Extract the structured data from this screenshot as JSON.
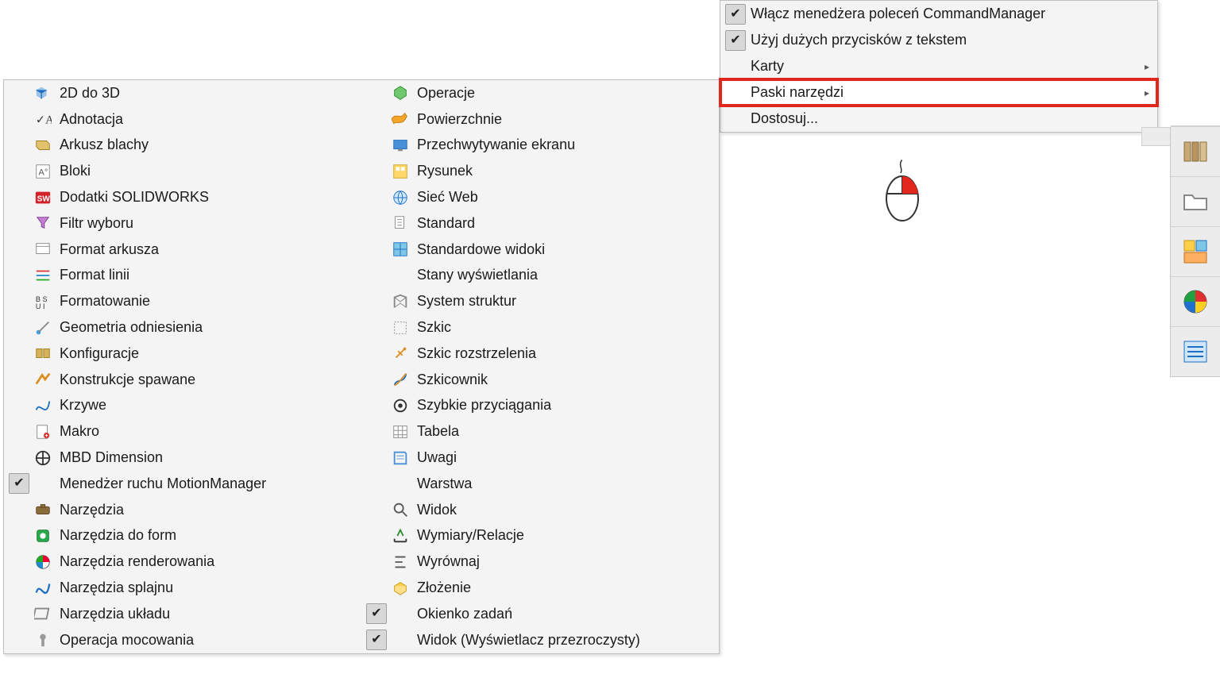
{
  "context_menu": {
    "items": [
      {
        "label": "Włącz menedżera poleceń CommandManager",
        "checked": true,
        "submenu": false,
        "highlight": false
      },
      {
        "label": "Użyj dużych przycisków z tekstem",
        "checked": true,
        "submenu": false,
        "highlight": false
      },
      {
        "label": "Karty",
        "checked": false,
        "submenu": true,
        "highlight": false
      },
      {
        "label": "Paski narzędzi",
        "checked": false,
        "submenu": true,
        "highlight": true
      },
      {
        "label": "Dostosuj...",
        "checked": false,
        "submenu": false,
        "highlight": false
      }
    ]
  },
  "toolbars_submenu": {
    "col1": [
      {
        "label": "2D do 3D",
        "icon": "cube-2d3d",
        "checked": false
      },
      {
        "label": "Adnotacja",
        "icon": "annotation",
        "checked": false
      },
      {
        "label": "Arkusz blachy",
        "icon": "sheetmetal",
        "checked": false
      },
      {
        "label": "Bloki",
        "icon": "blocks",
        "checked": false
      },
      {
        "label": "Dodatki SOLIDWORKS",
        "icon": "sw-addins",
        "checked": false
      },
      {
        "label": "Filtr wyboru",
        "icon": "filter",
        "checked": false
      },
      {
        "label": "Format arkusza",
        "icon": "sheet-format",
        "checked": false
      },
      {
        "label": "Format linii",
        "icon": "line-format",
        "checked": false
      },
      {
        "label": "Formatowanie",
        "icon": "formatting",
        "checked": false
      },
      {
        "label": "Geometria odniesienia",
        "icon": "ref-geom",
        "checked": false
      },
      {
        "label": "Konfiguracje",
        "icon": "configs",
        "checked": false
      },
      {
        "label": "Konstrukcje spawane",
        "icon": "weldments",
        "checked": false
      },
      {
        "label": "Krzywe",
        "icon": "curves",
        "checked": false
      },
      {
        "label": "Makro",
        "icon": "macro",
        "checked": false
      },
      {
        "label": "MBD Dimension",
        "icon": "mbd",
        "checked": false
      },
      {
        "label": "Menedżer ruchu MotionManager",
        "icon": "none",
        "checked": true
      },
      {
        "label": "Narzędzia",
        "icon": "tools",
        "checked": false
      },
      {
        "label": "Narzędzia do form",
        "icon": "mold-tools",
        "checked": false
      },
      {
        "label": "Narzędzia renderowania",
        "icon": "render-tools",
        "checked": false
      },
      {
        "label": "Narzędzia splajnu",
        "icon": "spline-tools",
        "checked": false
      },
      {
        "label": "Narzędzia układu",
        "icon": "layout-tools",
        "checked": false
      },
      {
        "label": "Operacja mocowania",
        "icon": "fastening",
        "checked": false
      }
    ],
    "col2": [
      {
        "label": "Operacje",
        "icon": "features",
        "checked": false
      },
      {
        "label": "Powierzchnie",
        "icon": "surfaces",
        "checked": false
      },
      {
        "label": "Przechwytywanie ekranu",
        "icon": "screen-cap",
        "checked": false
      },
      {
        "label": "Rysunek",
        "icon": "drawing",
        "checked": false
      },
      {
        "label": "Sieć Web",
        "icon": "web",
        "checked": false
      },
      {
        "label": "Standard",
        "icon": "standard",
        "checked": false
      },
      {
        "label": "Standardowe widoki",
        "icon": "std-views",
        "checked": false
      },
      {
        "label": "Stany wyświetlania",
        "icon": "none",
        "checked": false
      },
      {
        "label": "System struktur",
        "icon": "struct-sys",
        "checked": false
      },
      {
        "label": "Szkic",
        "icon": "sketch",
        "checked": false
      },
      {
        "label": "Szkic rozstrzelenia",
        "icon": "explode-sk",
        "checked": false
      },
      {
        "label": "Szkicownik",
        "icon": "sketcher",
        "checked": false
      },
      {
        "label": "Szybkie przyciągania",
        "icon": "quick-snaps",
        "checked": false
      },
      {
        "label": "Tabela",
        "icon": "table",
        "checked": false
      },
      {
        "label": "Uwagi",
        "icon": "notes",
        "checked": false
      },
      {
        "label": "Warstwa",
        "icon": "none",
        "checked": false
      },
      {
        "label": "Widok",
        "icon": "view",
        "checked": false
      },
      {
        "label": "Wymiary/Relacje",
        "icon": "dims-rel",
        "checked": false
      },
      {
        "label": "Wyrównaj",
        "icon": "align",
        "checked": false
      },
      {
        "label": "Złożenie",
        "icon": "assembly",
        "checked": false
      },
      {
        "label": "Okienko zadań",
        "icon": "none",
        "checked": true
      },
      {
        "label": "Widok (Wyświetlacz przezroczysty)",
        "icon": "none",
        "checked": true
      }
    ]
  },
  "right_dock": {
    "buttons": [
      {
        "name": "library-icon",
        "glyph": "books"
      },
      {
        "name": "open-icon",
        "glyph": "folder"
      },
      {
        "name": "palette-icon",
        "glyph": "blocks"
      },
      {
        "name": "appearance-icon",
        "glyph": "sphere"
      },
      {
        "name": "properties-icon",
        "glyph": "list"
      }
    ]
  }
}
